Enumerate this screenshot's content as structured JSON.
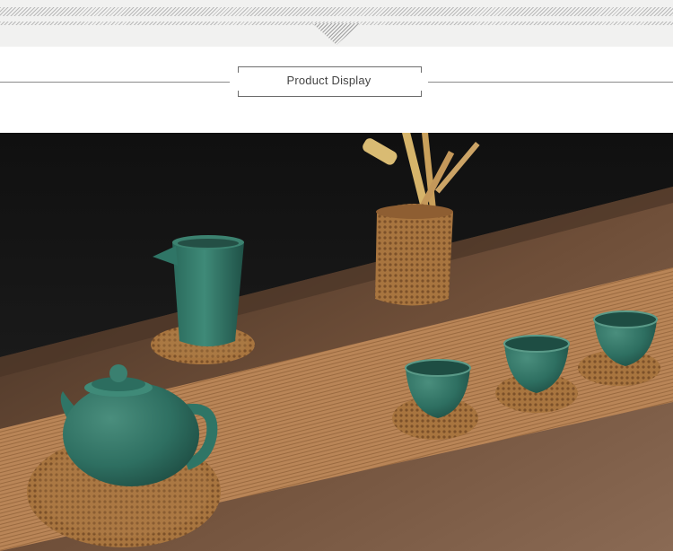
{
  "header": {
    "title": "Product Display"
  },
  "photo": {
    "subject": "tea-set-photo",
    "colors": {
      "backdrop": "#161616",
      "table": "#6b4a34",
      "bamboo_runner": "#b47f52",
      "ceramic": "#2f7566",
      "rattan": "#9b6a3c"
    }
  }
}
